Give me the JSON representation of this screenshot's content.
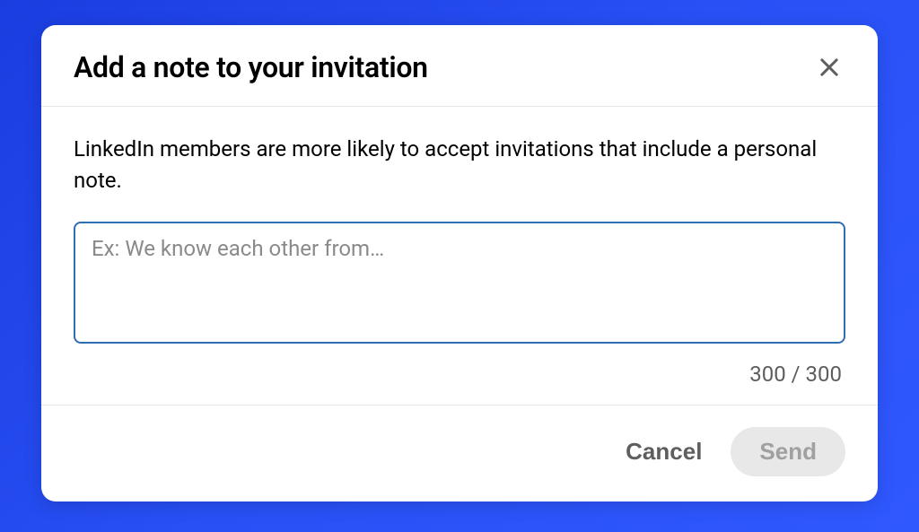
{
  "modal": {
    "title": "Add a note to your invitation",
    "description": "LinkedIn members are more likely to accept invitations that include a personal note.",
    "note_placeholder": "Ex: We know each other from…",
    "note_value": "",
    "char_counter": "300 / 300",
    "cancel_label": "Cancel",
    "send_label": "Send"
  }
}
